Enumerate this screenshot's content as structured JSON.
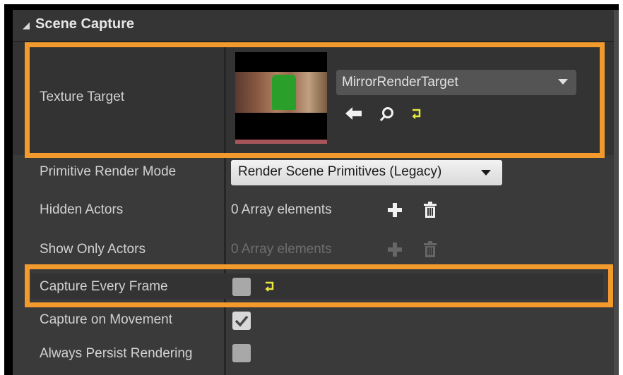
{
  "section": {
    "title": "Scene Capture",
    "collapse_icon": "triangle-down-icon"
  },
  "texture_target": {
    "label": "Texture Target",
    "asset_name": "MirrorRenderTarget",
    "icons": [
      "use-selected-arrow-icon",
      "browse-magnifier-icon",
      "reset-to-default-icon"
    ]
  },
  "primitive_render_mode": {
    "label": "Primitive Render Mode",
    "value": "Render Scene Primitives (Legacy)"
  },
  "hidden_actors": {
    "label": "Hidden Actors",
    "value": "0 Array elements"
  },
  "show_only_actors": {
    "label": "Show Only Actors",
    "value": "0 Array elements"
  },
  "capture_every_frame": {
    "label": "Capture Every Frame",
    "checked": false
  },
  "capture_on_movement": {
    "label": "Capture on Movement",
    "checked": true
  },
  "always_persist_rendering": {
    "label": "Always Persist Rendering",
    "checked": false
  },
  "colors": {
    "panel_bg": "#3a3a3a",
    "highlight_orange": "#f39a2c",
    "reset_icon_yellow": "#e8e840"
  }
}
